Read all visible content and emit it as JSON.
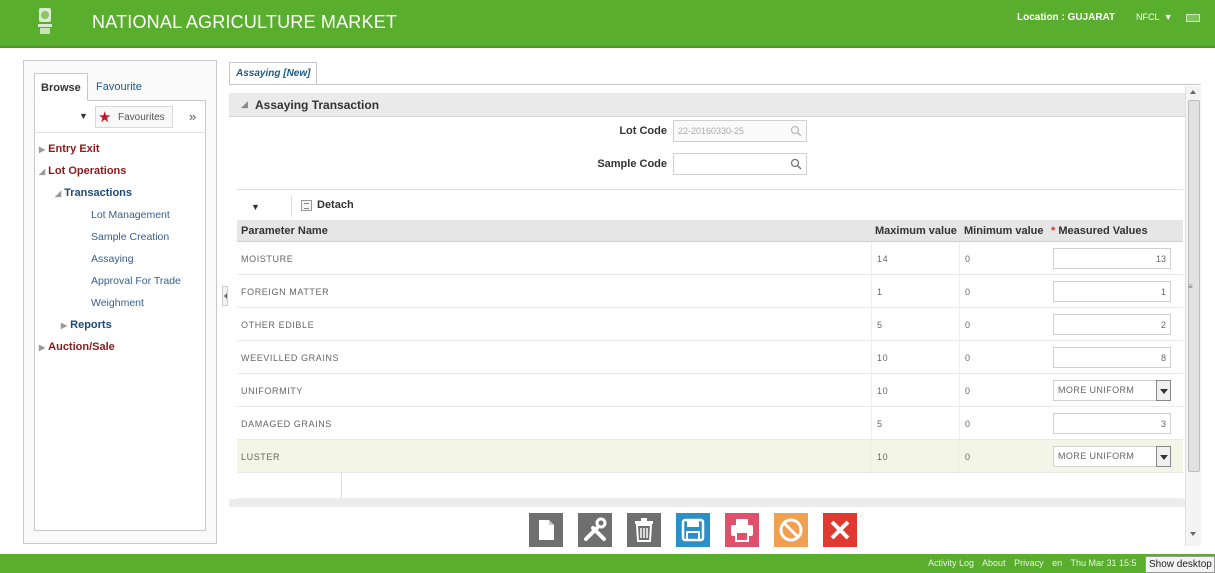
{
  "header": {
    "title": "NATIONAL AGRICULTURE MARKET",
    "location": "Location : GUJARAT",
    "user": "NFCL",
    "brand_color": "#5aae2e"
  },
  "left_panel": {
    "tabs": [
      {
        "label": "Browse"
      },
      {
        "label": "Favourite"
      }
    ],
    "favourites_label": "Favourites",
    "tree": {
      "entry_exit": "Entry Exit",
      "lot_operations": "Lot Operations",
      "transactions": "Transactions",
      "items": [
        {
          "label": "Lot Management"
        },
        {
          "label": "Sample Creation"
        },
        {
          "label": "Assaying"
        },
        {
          "label": "Approval For Trade"
        },
        {
          "label": "Weighment"
        }
      ],
      "reports": "Reports",
      "auction_sale": "Auction/Sale"
    }
  },
  "main": {
    "tab_label": "Assaying [New]",
    "section_title": "Assaying Transaction",
    "lot_code_label": "Lot Code",
    "lot_code_value": "22-20160330-25",
    "sample_code_label": "Sample Code",
    "sample_code_value": "",
    "detach_label": "Detach",
    "table": {
      "headers": {
        "parameter": "Parameter Name",
        "max": "Maximum value",
        "min": "Minimum value",
        "required_mark": "*",
        "measured": "Measured Values"
      },
      "rows": [
        {
          "name": "MOISTURE",
          "max": "14",
          "min": "0",
          "measured": "13"
        },
        {
          "name": "FOREIGN MATTER",
          "max": "1",
          "min": "0",
          "measured": "1"
        },
        {
          "name": "OTHER EDIBLE",
          "max": "5",
          "min": "0",
          "measured": "2"
        },
        {
          "name": "WEEVILLED GRAINS",
          "max": "10",
          "min": "0",
          "measured": "8"
        },
        {
          "name": "UNIFORMITY",
          "max": "10",
          "min": "0",
          "measured": "MORE UNIFORM"
        },
        {
          "name": "DAMAGED GRAINS",
          "max": "5",
          "min": "0",
          "measured": "3"
        },
        {
          "name": "LUSTER",
          "max": "10",
          "min": "0",
          "measured": "MORE UNIFORM"
        }
      ]
    },
    "actions": [
      {
        "icon": "new-document-icon",
        "color": "#6f6f6f"
      },
      {
        "icon": "tools-icon",
        "color": "#6f6f6f"
      },
      {
        "icon": "trash-icon",
        "color": "#6f6f6f"
      },
      {
        "icon": "save-icon",
        "color": "#2b8fc8"
      },
      {
        "icon": "print-icon",
        "color": "#e0506a"
      },
      {
        "icon": "cancel-icon",
        "color": "#f0a050"
      },
      {
        "icon": "close-icon",
        "color": "#e03a30"
      }
    ]
  },
  "footer": {
    "links": [
      "Activity Log",
      "About",
      "Privacy",
      "en",
      "Thu Mar 31 15:5"
    ],
    "show_desktop": "Show desktop"
  }
}
